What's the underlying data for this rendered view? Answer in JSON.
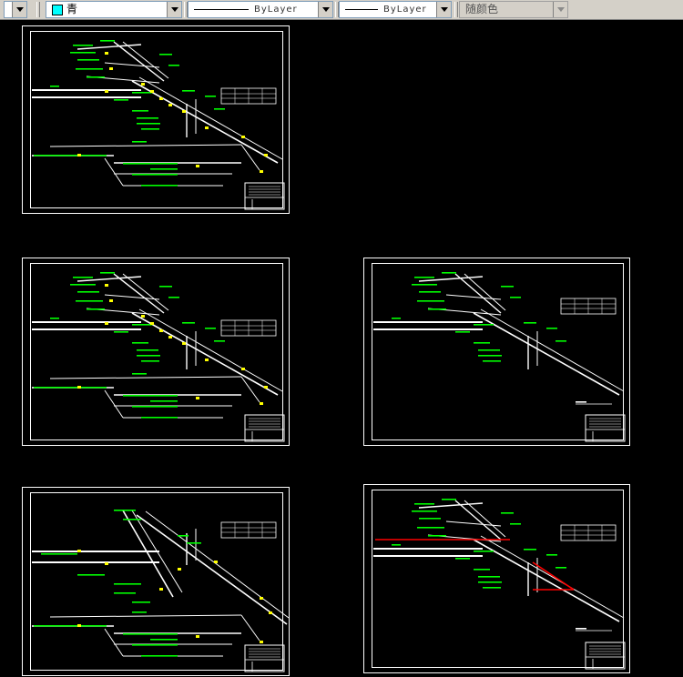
{
  "toolbar": {
    "color_control": {
      "swatch": "#00ffff",
      "label": "青"
    },
    "linetype_control": {
      "label": "ByLayer"
    },
    "lineweight_control": {
      "label": "ByLayer"
    },
    "plotstyle_control": {
      "label": "随颜色"
    }
  },
  "colors": {
    "background": "#000000",
    "linework": "#ffffff",
    "annotation_green": "#00ff00",
    "marker_yellow": "#ffff00",
    "highlight_red": "#ff0000"
  }
}
